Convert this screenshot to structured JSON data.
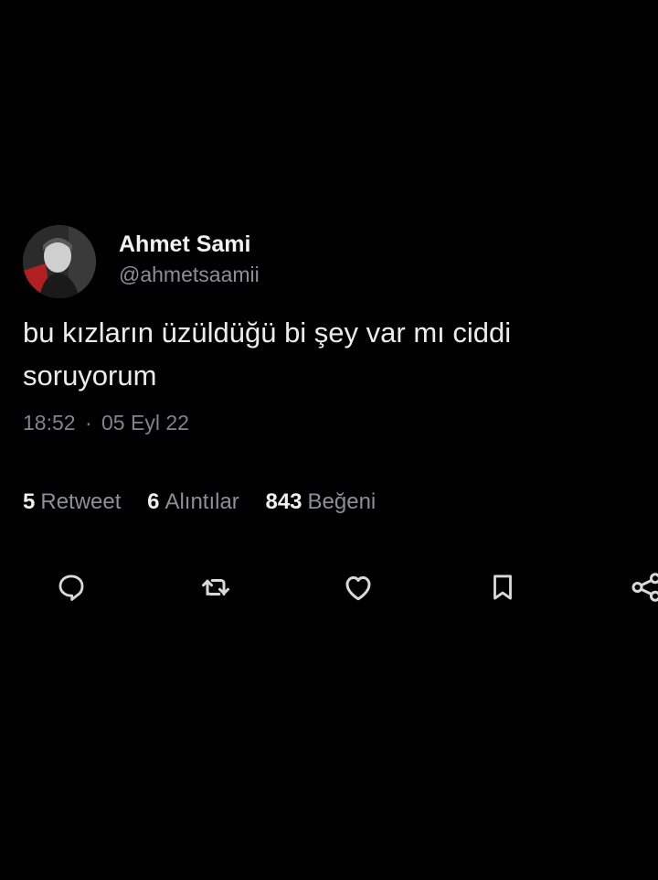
{
  "author": {
    "display_name": "Ahmet Sami",
    "handle": "@ahmetsaamii"
  },
  "tweet": {
    "text": "bu kızların üzüldüğü bi şey var mı ciddi soruyorum",
    "time": "18:52",
    "separator": "·",
    "date": "05 Eyl 22"
  },
  "stats": [
    {
      "count": "5",
      "label": "Retweet"
    },
    {
      "count": "6",
      "label": "Alıntılar"
    },
    {
      "count": "843",
      "label": "Beğeni"
    }
  ],
  "actions": {
    "icons": [
      "reply-icon",
      "retweet-icon",
      "like-icon",
      "bookmark-icon",
      "share-icon"
    ]
  },
  "colors": {
    "background": "#000000",
    "text_primary": "#e7e9ea",
    "text_secondary": "#8b9096",
    "icon": "#d9d9d9"
  }
}
